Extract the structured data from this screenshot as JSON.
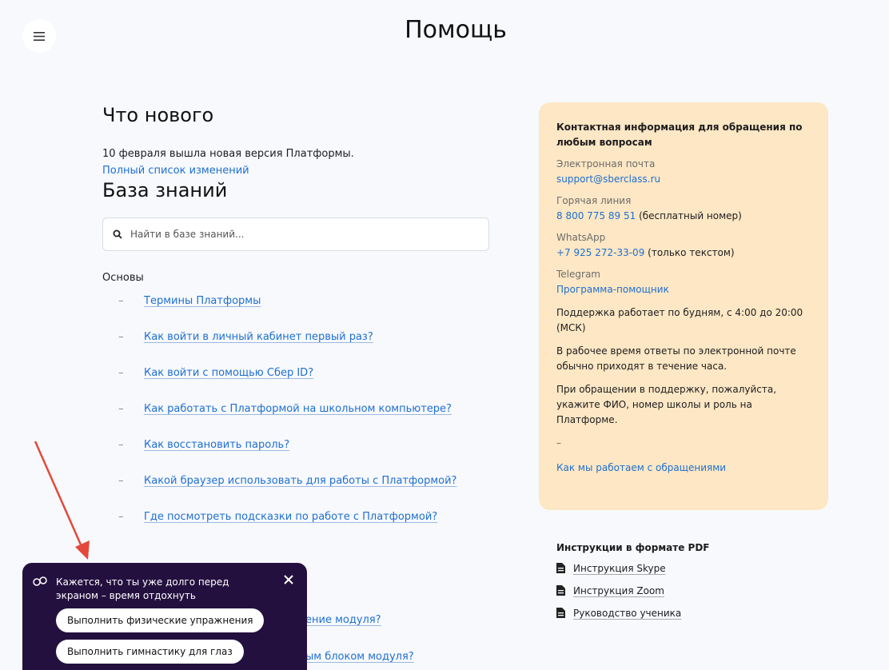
{
  "header": {
    "title": "Помощь",
    "menu_icon": "hamburger-icon"
  },
  "whats_new": {
    "title": "Что нового",
    "text": "10 февраля вышла новая версия Платформы.",
    "link": "Полный список изменений"
  },
  "knowledge_base": {
    "title": "База знаний",
    "search_placeholder": "Найти в базе знаний...",
    "group_title": "Основы",
    "articles": [
      "Термины Платформы",
      "Как войти в личный кабинет первый раз?",
      "Как войти с помощью Сбер ID?",
      "Как работать с Платформой на школьном компьютере?",
      "Как восстановить пароль?",
      "Какой браузер использовать для работы с Платформой?",
      "Где посмотреть подсказки по работе с Платформой?"
    ],
    "partial_articles": [
      "ение модуля?",
      "ым блоком модуля?"
    ]
  },
  "contact": {
    "title": "Контактная информация для обращения по любым вопросам",
    "email_label": "Электронная почта",
    "email": "support@sberclass.ru",
    "hotline_label": "Горячая линия",
    "hotline": "8 800 775 89 51",
    "hotline_note": "(бесплатный номер)",
    "whatsapp_label": "WhatsApp",
    "whatsapp": "+7 925 272-33-09",
    "whatsapp_note": "(только текстом)",
    "telegram_label": "Telegram",
    "telegram": "Программа-помощник",
    "hours": "Поддержка работает по будням, с 4:00 до 20:00 (МСК)",
    "response": "В рабочее время ответы по электронной почте обычно приходят в течение часа.",
    "request": "При обращении в поддержку, пожалуйста, укажите ФИО, номер школы и роль на Платформе.",
    "dash": "–",
    "how_link": "Как мы работаем с обращениями"
  },
  "pdf": {
    "title": "Инструкции в формате PDF",
    "items": [
      "Инструкция Skype",
      "Инструкция Zoom",
      "Руководство ученика"
    ]
  },
  "toast": {
    "message": "Кажется, что ты уже долго перед экраном – время отдохнуть",
    "button_exercise": "Выполнить физические упражнения",
    "button_eyes": "Выполнить гимнастику для глаз"
  },
  "colors": {
    "link": "#1f6fd1",
    "card_bg": "#fde7c4",
    "toast_bg": "#24103f",
    "arrow": "#e5483b"
  }
}
